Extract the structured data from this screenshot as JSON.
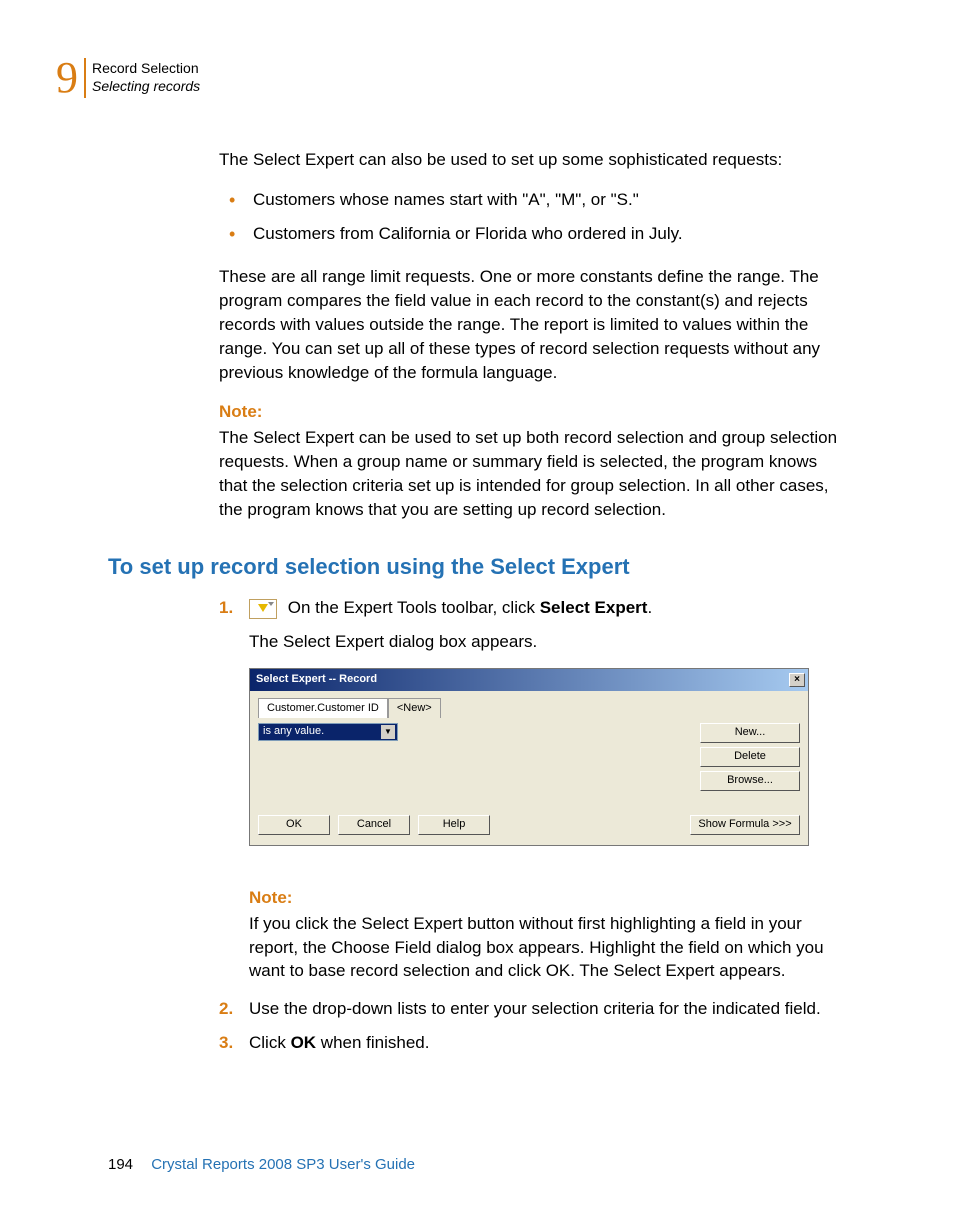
{
  "header": {
    "chapter_number": "9",
    "title": "Record Selection",
    "subtitle": "Selecting records"
  },
  "body": {
    "intro": "The Select Expert can also be used to set up some sophisticated requests:",
    "bullet1": "Customers whose names start with \"A\", \"M\", or \"S.\"",
    "bullet2": "Customers from California or Florida who ordered in July.",
    "range_para": "These are all range limit requests. One or more constants define the range. The program compares the field value in each record to the constant(s) and rejects records with values outside the range. The report is limited to values within the range. You can set up all of these types of record selection requests without any previous knowledge of the formula language.",
    "note1_label": "Note:",
    "note1_text": "The Select Expert can be used to set up both record selection and group selection requests. When a group name or summary field is selected, the program knows that the selection criteria set up is intended for group selection. In all other cases, the program knows that you are setting up record selection."
  },
  "section_heading": "To set up record selection using the Select Expert",
  "steps": {
    "s1_num": "1.",
    "s1_pre": "On the Expert Tools toolbar, click ",
    "s1_bold": "Select Expert",
    "s1_post": ".",
    "s1_sub": "The Select Expert dialog box appears.",
    "note2_label": "Note:",
    "note2_text": "If you click the Select Expert button without first highlighting a field in your report, the Choose Field dialog box appears. Highlight the field on which you want to base record selection and click OK. The Select Expert appears.",
    "s2_num": "2.",
    "s2_text": "Use the drop-down lists to enter your selection criteria for the indicated field.",
    "s3_num": "3.",
    "s3_pre": "Click ",
    "s3_bold": "OK",
    "s3_post": " when finished."
  },
  "dialog": {
    "title": "Select Expert -- Record",
    "tab1": "Customer.Customer ID",
    "tab2": "<New>",
    "dropdown_value": "is any value.",
    "btn_new": "New...",
    "btn_delete": "Delete",
    "btn_browse": "Browse...",
    "btn_ok": "OK",
    "btn_cancel": "Cancel",
    "btn_help": "Help",
    "btn_show_formula": "Show Formula >>>",
    "close_x": "×"
  },
  "footer": {
    "page": "194",
    "text": "Crystal Reports 2008 SP3 User's Guide"
  }
}
